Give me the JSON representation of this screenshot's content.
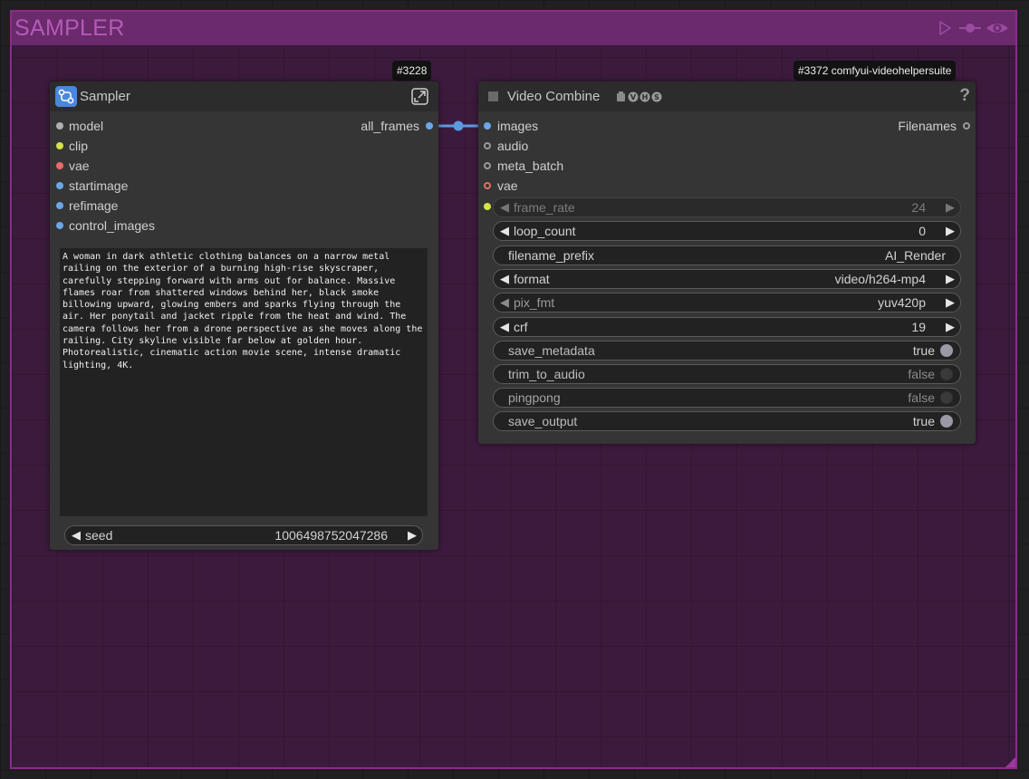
{
  "group": {
    "title": "SAMPLER",
    "color": "#6a2a6c"
  },
  "link": {
    "color": "#5b9be0"
  },
  "sampler_node": {
    "badge": "#3228",
    "title": "Sampler",
    "icon": "workflow-icon",
    "header_action_icon": "expand-subgraph-icon",
    "inputs": [
      {
        "label": "model",
        "color": "#b0b0b0"
      },
      {
        "label": "clip",
        "color": "#d6e24a"
      },
      {
        "label": "vae",
        "color": "#e86a6a"
      },
      {
        "label": "startimage",
        "color": "#6aa6e8"
      },
      {
        "label": "refimage",
        "color": "#6aa6e8"
      },
      {
        "label": "control_images",
        "color": "#6aa6e8"
      }
    ],
    "output": {
      "label": "all_frames",
      "color": "#6aa6e8"
    },
    "prompt_text": "A woman in dark athletic clothing balances on a narrow metal railing on the exterior of a burning high-rise skyscraper, carefully stepping forward with arms out for balance. Massive flames roar from shattered windows behind her, black smoke billowing upward, glowing embers and sparks flying through the air. Her ponytail and jacket ripple from the heat and wind. The camera follows her from a drone perspective as she moves along the railing. City skyline visible far below at golden hour. Photorealistic, cinematic action movie scene, intense dramatic lighting, 4K.",
    "seed": {
      "name": "seed",
      "value": "1006498752047286"
    }
  },
  "video_node": {
    "badge": "#3372 comfyui-videohelpersuite",
    "title": "Video Combine",
    "title_suffix_icons": [
      "robot-icon",
      "v-badge-icon",
      "h-badge-icon",
      "s-badge-icon"
    ],
    "help": "?",
    "inputs": [
      {
        "label": "images",
        "color": "#6aa6e8",
        "style": "filled"
      },
      {
        "label": "audio",
        "color": "#9a9a9a",
        "style": "hollow"
      },
      {
        "label": "meta_batch",
        "color": "#9a9a9a",
        "style": "hollow"
      },
      {
        "label": "vae",
        "color": "#e86a6a",
        "style": "hollow"
      }
    ],
    "output": {
      "label": "Filenames",
      "color": "#9a9a9a"
    },
    "widgets": {
      "frame_rate": {
        "name": "frame_rate",
        "value": "24"
      },
      "loop_count": {
        "name": "loop_count",
        "value": "0"
      },
      "filename_prefix": {
        "name": "filename_prefix",
        "value": "AI_Render"
      },
      "format": {
        "name": "format",
        "value": "video/h264-mp4"
      },
      "pix_fmt": {
        "name": "pix_fmt",
        "value": "yuv420p"
      },
      "crf": {
        "name": "crf",
        "value": "19"
      },
      "save_metadata": {
        "name": "save_metadata",
        "value": "true"
      },
      "trim_to_audio": {
        "name": "trim_to_audio",
        "value": "false"
      },
      "pingpong": {
        "name": "pingpong",
        "value": "false"
      },
      "save_output": {
        "name": "save_output",
        "value": "true"
      }
    },
    "frame_rate_input_color": "#d6e24a"
  },
  "glyphs": {
    "left": "◀",
    "right": "▶"
  }
}
